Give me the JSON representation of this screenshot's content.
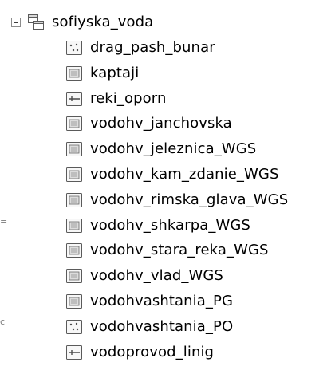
{
  "tree": {
    "group": {
      "name": "sofiyska_voda",
      "expanded": true,
      "icon": "group-layer-icon"
    },
    "layers": [
      {
        "name": "drag_pash_bunar",
        "type": "point",
        "icon": "point-layer-icon"
      },
      {
        "name": "kaptaji",
        "type": "raster",
        "icon": "polygon-layer-icon"
      },
      {
        "name": "reki_oporn",
        "type": "line",
        "icon": "line-layer-icon"
      },
      {
        "name": "vodohv_janchovska",
        "type": "raster",
        "icon": "polygon-layer-icon"
      },
      {
        "name": "vodohv_jeleznica_WGS",
        "type": "raster",
        "icon": "polygon-layer-icon"
      },
      {
        "name": "vodohv_kam_zdanie_WGS",
        "type": "raster",
        "icon": "polygon-layer-icon"
      },
      {
        "name": "vodohv_rimska_glava_WGS",
        "type": "raster",
        "icon": "polygon-layer-icon"
      },
      {
        "name": "vodohv_shkarpa_WGS",
        "type": "raster",
        "icon": "polygon-layer-icon"
      },
      {
        "name": "vodohv_stara_reka_WGS",
        "type": "raster",
        "icon": "polygon-layer-icon"
      },
      {
        "name": "vodohv_vlad_WGS",
        "type": "raster",
        "icon": "polygon-layer-icon"
      },
      {
        "name": "vodohvashtania_PG",
        "type": "raster",
        "icon": "polygon-layer-icon"
      },
      {
        "name": "vodohvashtania_PO",
        "type": "point",
        "icon": "point-layer-icon"
      },
      {
        "name": "vodoprovod_linig",
        "type": "line",
        "icon": "line-layer-icon"
      }
    ]
  },
  "colors": {
    "background": "#ffffff",
    "text": "#000000",
    "icon_border": "#5a5a5a",
    "icon_fill": "#f2f2f2",
    "icon_accent": "#8a8a8a"
  }
}
